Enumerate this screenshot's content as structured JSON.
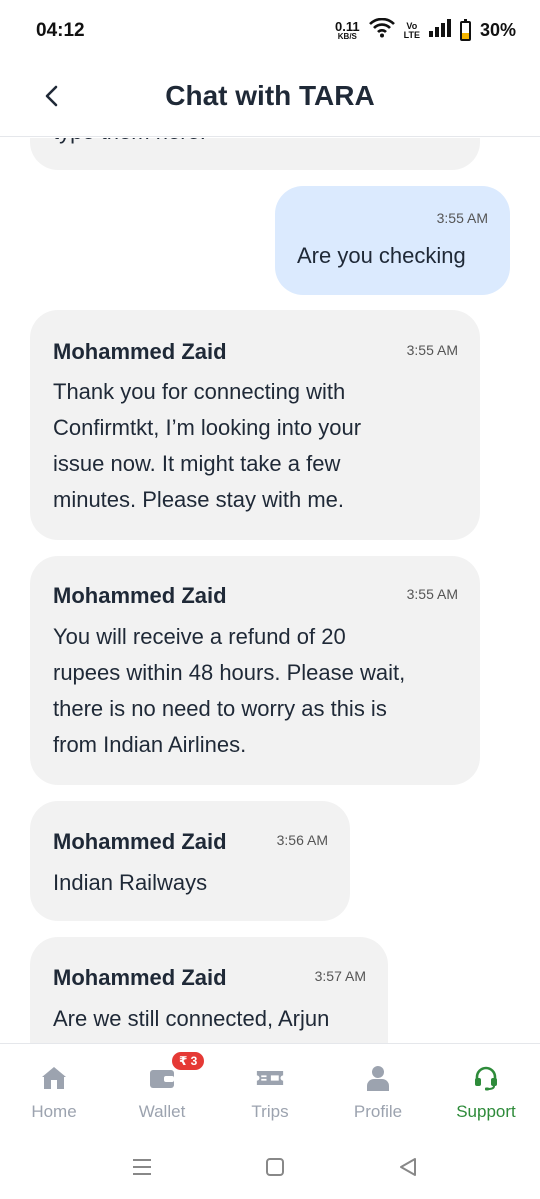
{
  "status_bar": {
    "time": "04:12",
    "net_speed_value": "0.11",
    "net_speed_unit": "KB/S",
    "volte_top": "Vo",
    "volte_bottom": "LTE",
    "battery_percent": "30%"
  },
  "header": {
    "title": "Chat with TARA"
  },
  "messages": [
    {
      "sender": "",
      "time": "",
      "lines": [
        "type them here."
      ],
      "from": "agent"
    },
    {
      "sender": "",
      "time": "3:55 AM",
      "lines": [
        "Are you checking"
      ],
      "from": "user"
    },
    {
      "sender": "Mohammed Zaid",
      "time": "3:55 AM",
      "lines": [
        "Thank you for connecting with",
        "Confirmtkt, I’m looking into your",
        "issue now. It might take a few",
        "minutes. Please stay with me."
      ],
      "from": "agent"
    },
    {
      "sender": "Mohammed Zaid",
      "time": "3:55 AM",
      "lines": [
        "You will receive a refund of 20",
        "rupees within 48 hours. Please wait,",
        "there is no need to worry as this is",
        "from Indian Airlines."
      ],
      "from": "agent"
    },
    {
      "sender": "Mohammed Zaid",
      "time": "3:56 AM",
      "lines": [
        "Indian Railways"
      ],
      "from": "agent"
    },
    {
      "sender": "Mohammed Zaid",
      "time": "3:57 AM",
      "lines": [
        "Are we still connected, Arjun"
      ],
      "from": "agent"
    }
  ],
  "bottom_nav": {
    "items": [
      {
        "label": "Home",
        "icon": "home-icon"
      },
      {
        "label": "Wallet",
        "icon": "wallet-icon",
        "badge": "₹ 3"
      },
      {
        "label": "Trips",
        "icon": "ticket-icon"
      },
      {
        "label": "Profile",
        "icon": "person-icon"
      },
      {
        "label": "Support",
        "icon": "headset-icon",
        "active": true
      }
    ]
  },
  "colors": {
    "agent_bubble": "#f2f2f2",
    "user_bubble": "#dbeafe",
    "active_nav": "#2e8b3a",
    "badge": "#e53935"
  }
}
